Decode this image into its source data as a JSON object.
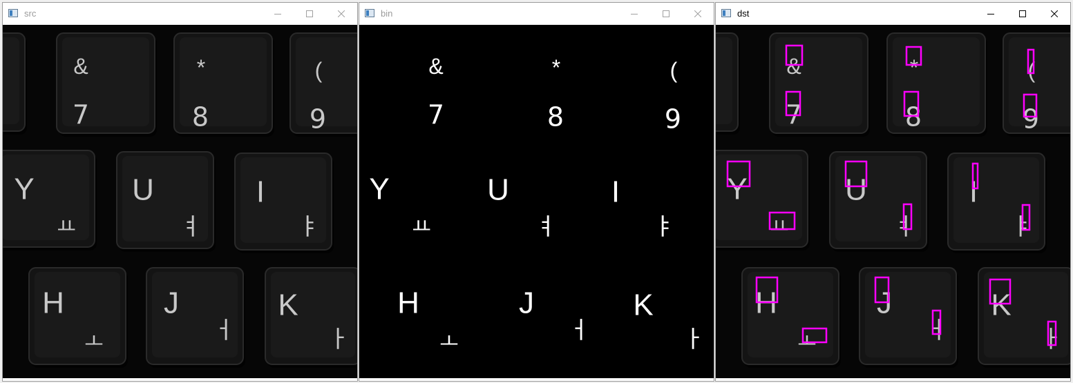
{
  "windows": [
    {
      "id": "src",
      "title": "src",
      "kind": "photo"
    },
    {
      "id": "bin",
      "title": "bin",
      "kind": "binary"
    },
    {
      "id": "dst",
      "title": "dst",
      "kind": "boxed",
      "active": true
    }
  ],
  "controls": {
    "minimize": "minimize-icon",
    "maximize": "maximize-icon",
    "close": "close-icon"
  },
  "keyboard": {
    "keys": [
      {
        "top": "&",
        "bottom": "7"
      },
      {
        "top": "*",
        "bottom": "8"
      },
      {
        "top": "(",
        "bottom": "9"
      },
      {
        "top": "Y",
        "bottom": "ㅛ"
      },
      {
        "top": "U",
        "bottom": "ㅕ"
      },
      {
        "top": "I",
        "bottom": "ㅑ"
      },
      {
        "top": "H",
        "bottom": "ㅗ"
      },
      {
        "top": "J",
        "bottom": "ㅓ"
      },
      {
        "top": "K",
        "bottom": "ㅏ"
      }
    ]
  },
  "colors": {
    "box": "#ff00ff",
    "key_label": "#c8c8c8",
    "binary_text": "#ffffff",
    "key_face": "#141414",
    "background": "#060606"
  }
}
